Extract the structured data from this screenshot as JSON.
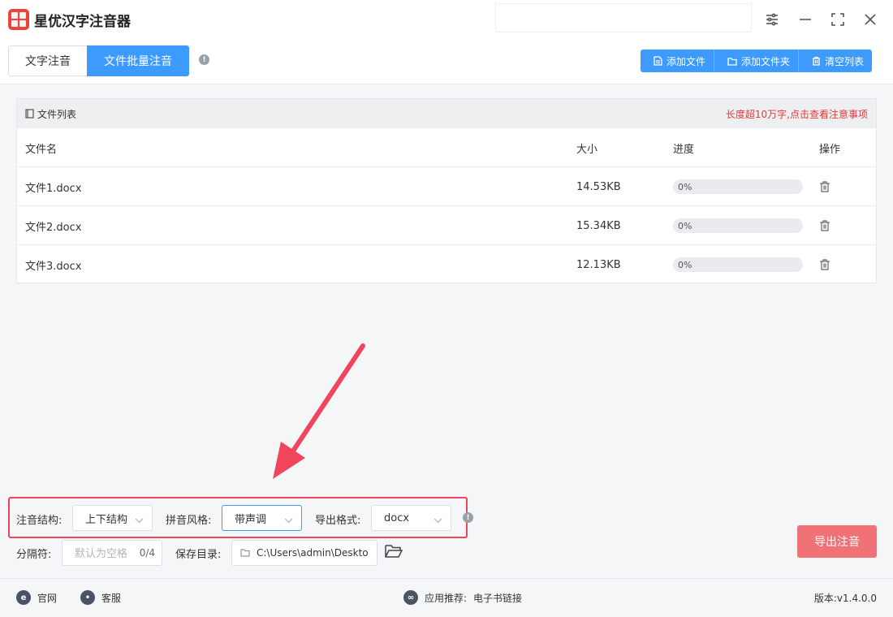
{
  "app": {
    "title": "星优汉字注音器"
  },
  "tabs": {
    "text": "文字注音",
    "batch": "文件批量注音"
  },
  "toolbar": {
    "add_file": "添加文件",
    "add_folder": "添加文件夹",
    "clear_list": "清空列表"
  },
  "filelist": {
    "title": "文件列表",
    "note": "长度超10万字,点击查看注意事项",
    "headers": {
      "name": "文件名",
      "size": "大小",
      "progress": "进度",
      "action": "操作"
    },
    "rows": [
      {
        "name": "文件1.docx",
        "size": "14.53KB",
        "progress": "0%"
      },
      {
        "name": "文件2.docx",
        "size": "15.34KB",
        "progress": "0%"
      },
      {
        "name": "文件3.docx",
        "size": "12.13KB",
        "progress": "0%"
      }
    ]
  },
  "settings": {
    "structure_label": "注音结构:",
    "structure_value": "上下结构",
    "style_label": "拼音风格:",
    "style_value": "带声调",
    "format_label": "导出格式:",
    "format_value": "docx",
    "separator_label": "分隔符:",
    "separator_placeholder": "默认为空格",
    "separator_count": "0/4",
    "savedir_label": "保存目录:",
    "savedir_value": "C:\\Users\\admin\\Deskto",
    "export_button": "导出注音"
  },
  "footer": {
    "website": "官网",
    "support": "客服",
    "recommend_label": "应用推荐:",
    "recommend_link": "电子书链接",
    "version": "版本:v1.4.0.0"
  },
  "colors": {
    "accent": "#3d9bff",
    "danger": "#f0455d",
    "export": "#f07277",
    "note": "#e23a3a"
  }
}
